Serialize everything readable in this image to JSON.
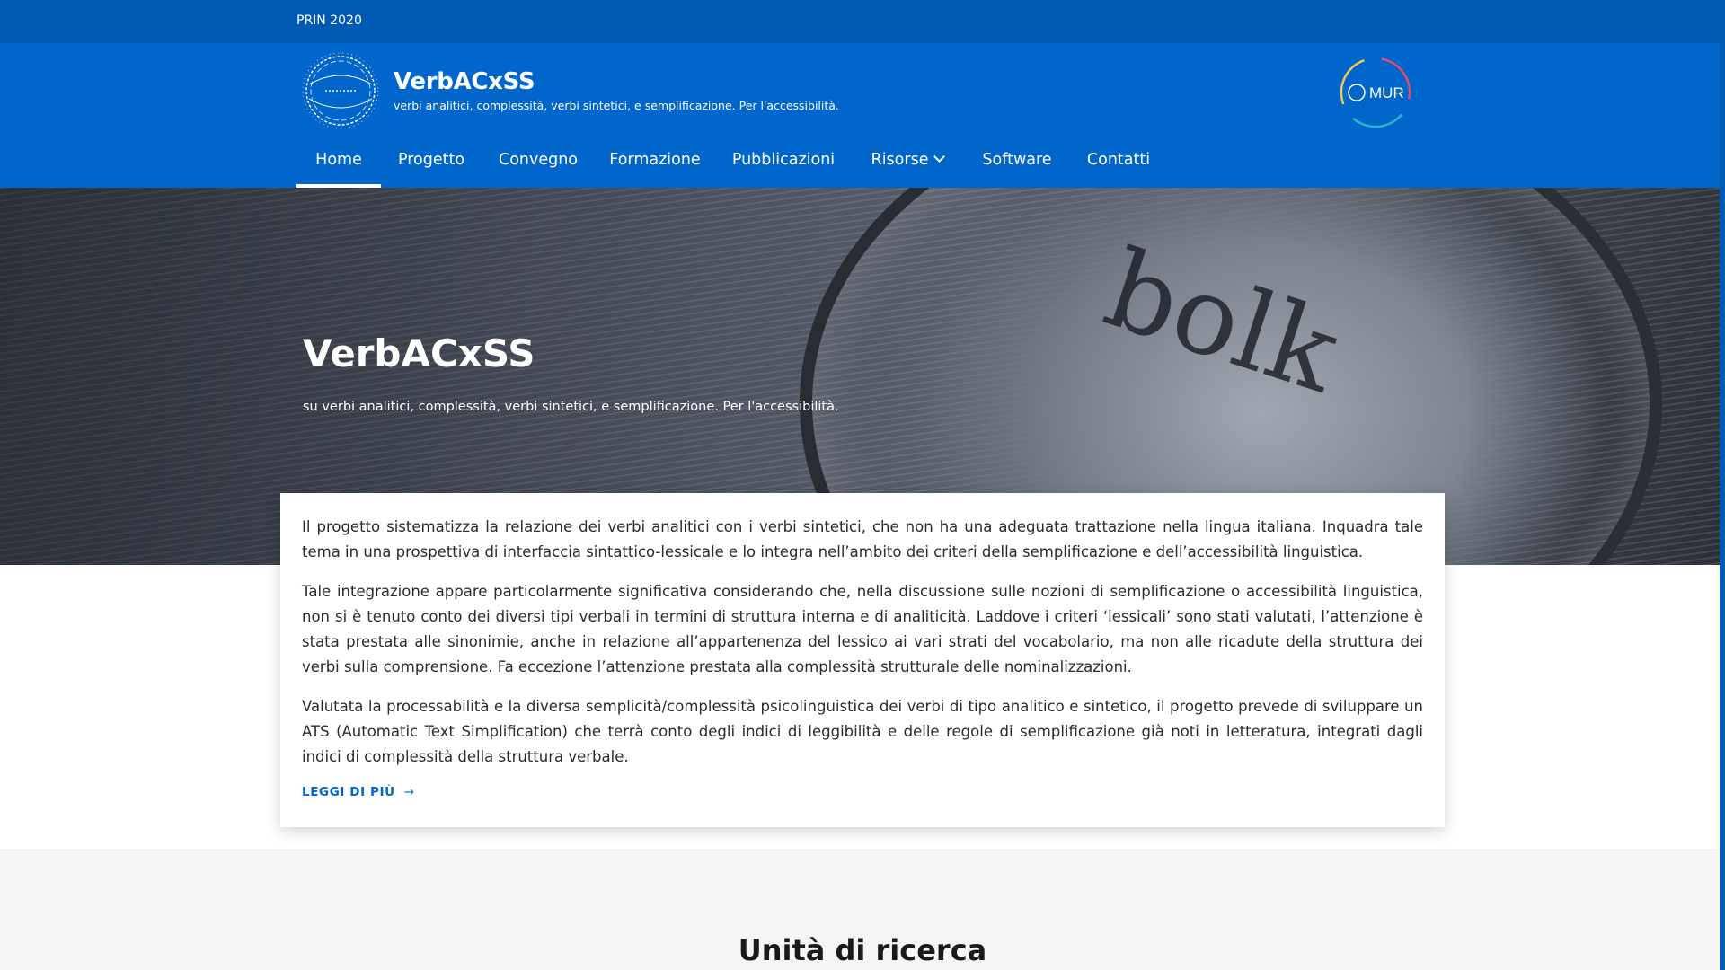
{
  "slim_header": {
    "label": "PRIN 2020"
  },
  "brand": {
    "title": "VerbACxSS",
    "subtitle": "verbi analitici, complessità, verbi sintetici, e semplificazione. Per l'accessibilità."
  },
  "partner_logo": {
    "text": "MUR"
  },
  "nav": {
    "items": [
      {
        "label": "Home",
        "active": true
      },
      {
        "label": "Progetto"
      },
      {
        "label": "Convegno"
      },
      {
        "label": "Formazione"
      },
      {
        "label": "Pubblicazioni"
      },
      {
        "label": "Risorse",
        "dropdown": true
      },
      {
        "label": "Software"
      },
      {
        "label": "Contatti"
      }
    ]
  },
  "hero": {
    "title": "VerbACxSS",
    "subtitle": "su verbi analitici, complessità, verbi sintetici, e semplificazione. Per l'accessibilità."
  },
  "intro": {
    "paragraphs": [
      "Il progetto sistematizza la relazione dei verbi analitici con i verbi sintetici, che non ha una adeguata trattazione nella lingua italiana. Inquadra tale tema in una prospettiva di interfaccia sintattico-lessicale e lo integra nell’ambito dei criteri della semplificazione e dell’accessibilità linguistica.",
      "Tale integrazione appare particolarmente significativa considerando che, nella discussione sulle nozioni di semplificazione o accessibilità linguistica, non si è tenuto conto dei diversi tipi verbali in termini di struttura interna e di analiticità. Laddove i criteri ‘lessicali’ sono stati valutati, l’attenzione è stata prestata alle sinonimie, anche in relazione all’appartenenza del lessico ai vari strati del vocabolario, ma non alle ricadute della struttura dei verbi sulla comprensione. Fa eccezione l’attenzione prestata alla complessità strutturale delle nominalizzazioni.",
      "Valutata la processabilità e la diversa semplicità/complessità psicolinguistica dei verbi di tipo analitico e sintetico, il progetto prevede di sviluppare un ATS (Automatic Text Simplification) che terrà conto degli indici di leggibilità e delle regole di semplificazione già noti in letteratura, integrati dagli indici di complessità della struttura verbale."
    ],
    "read_more_label": "LEGGI DI PIÙ",
    "read_more_icon": "arrow-right-icon"
  },
  "research_units": {
    "title": "Unità di ricerca"
  },
  "hero_image_text": "bolk",
  "colors": {
    "primary": "#0066cc",
    "primary_dark": "#0059b3",
    "surface": "#ffffff",
    "section_bg": "#f5f5f5"
  }
}
